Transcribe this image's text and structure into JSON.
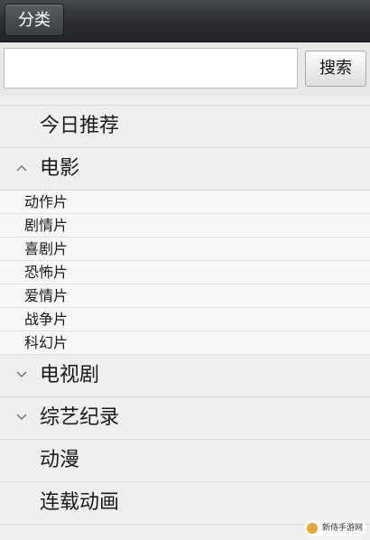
{
  "topbar": {
    "category_label": "分类"
  },
  "search": {
    "value": "",
    "placeholder": "",
    "button_label": "搜索"
  },
  "menu": {
    "today": "今日推荐",
    "movie": {
      "label": "电影",
      "expanded": true,
      "children": [
        "动作片",
        "剧情片",
        "喜剧片",
        "恐怖片",
        "爱情片",
        "战争片",
        "科幻片"
      ]
    },
    "tv": {
      "label": "电视剧",
      "expanded": false
    },
    "variety": {
      "label": "综艺纪录",
      "expanded": false
    },
    "anime": "动漫",
    "serial": "连载动画"
  },
  "watermark": {
    "text": "新侍手游网"
  },
  "colors": {
    "topbar": "#2b2d30",
    "background": "#efefef",
    "divider": "#d6d6d6"
  },
  "icons": {
    "expanded": "chevron-up-icon",
    "collapsed": "chevron-down-icon"
  }
}
